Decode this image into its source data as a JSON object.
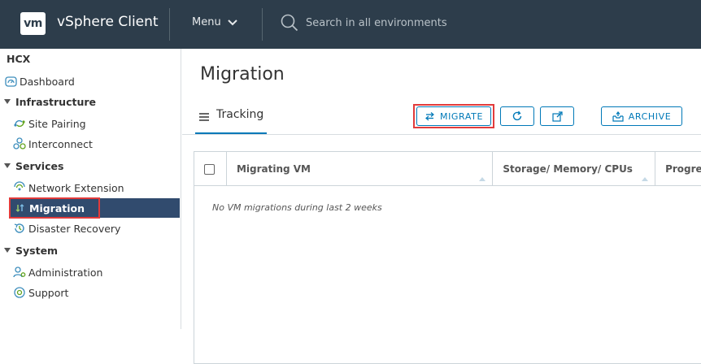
{
  "header": {
    "logo_text": "vm",
    "app_title": "vSphere Client",
    "menu_label": "Menu",
    "search_placeholder": "Search in all environments"
  },
  "sidebar": {
    "title": "HCX",
    "dashboard": "Dashboard",
    "sections": {
      "infrastructure": "Infrastructure",
      "services": "Services",
      "system": "System"
    },
    "items": {
      "site_pairing": "Site Pairing",
      "interconnect": "Interconnect",
      "network_extension": "Network Extension",
      "migration": "Migration",
      "disaster_recovery": "Disaster Recovery",
      "administration": "Administration",
      "support": "Support"
    }
  },
  "main": {
    "page_title": "Migration",
    "tab_label": "Tracking",
    "buttons": {
      "migrate": "MIGRATE",
      "archive": "ARCHIVE"
    },
    "table": {
      "columns": [
        "Migrating VM",
        "Storage/ Memory/ CPUs",
        "Progress"
      ],
      "empty_message": "No VM migrations during last 2 weeks"
    }
  },
  "colors": {
    "header_bg": "#2d3d4b",
    "accent": "#0079b8",
    "active_item_bg": "#314b6e",
    "highlight_border": "#e23b3b"
  },
  "icons": [
    "search-icon",
    "chevron-down-icon",
    "dashboard-icon",
    "site-pairing-icon",
    "interconnect-icon",
    "network-extension-icon",
    "migration-icon",
    "disaster-recovery-icon",
    "administration-icon",
    "support-icon",
    "tracking-list-icon",
    "migrate-arrows-icon",
    "refresh-icon",
    "external-link-icon",
    "archive-icon"
  ]
}
